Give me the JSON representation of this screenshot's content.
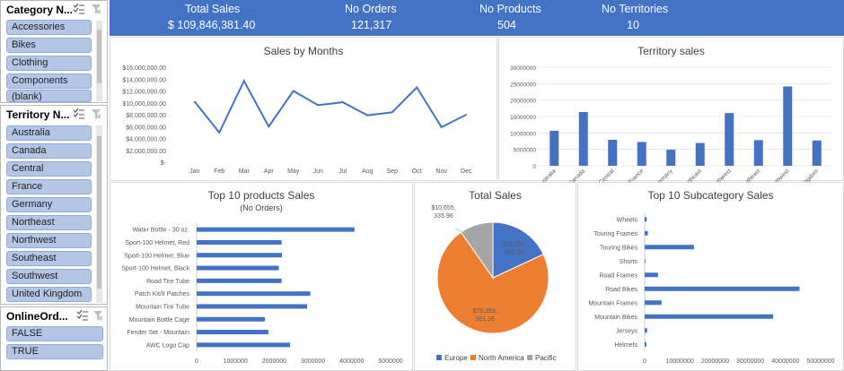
{
  "slicers": {
    "category": {
      "title": "Category N...",
      "items": [
        "Accessories",
        "Bikes",
        "Clothing",
        "Components",
        "(blank)"
      ]
    },
    "territory": {
      "title": "Territory N...",
      "items": [
        "Australia",
        "Canada",
        "Central",
        "France",
        "Germany",
        "Northeast",
        "Northwest",
        "Southeast",
        "Southwest",
        "United Kingdom"
      ]
    },
    "online_order": {
      "title": "OnlineOrd...",
      "items": [
        "FALSE",
        "TRUE"
      ]
    }
  },
  "kpis": [
    {
      "label": "Total Sales",
      "value": "$ 109,846,381.40"
    },
    {
      "label": "No Orders",
      "value": "121,317"
    },
    {
      "label": "No Products",
      "value": "504"
    },
    {
      "label": "No Territories",
      "value": "10"
    }
  ],
  "colors": {
    "accent": "#4472c4",
    "orange": "#ed7d31",
    "gray": "#a5a5a5",
    "slicer_item": "#b4c6e7"
  },
  "chart_data": [
    {
      "id": "sales_by_months",
      "type": "line",
      "title": "Sales by Months",
      "categories": [
        "Jan",
        "Feb",
        "Mar",
        "Apr",
        "May",
        "Jun",
        "Jul",
        "Aug",
        "Sep",
        "Oct",
        "Nov",
        "Dec"
      ],
      "values": [
        10200000,
        5000000,
        13700000,
        6000000,
        12000000,
        9600000,
        10100000,
        7900000,
        8400000,
        12600000,
        5900000,
        8000000
      ],
      "y_ticks": [
        "$-",
        "$2,000,000.00",
        "$4,000,000.00",
        "$6,000,000.00",
        "$8,000,000.00",
        "$10,000,000.00",
        "$12,000,000.00",
        "$14,000,000.00",
        "$16,000,000.00"
      ],
      "ylim": [
        0,
        16000000
      ],
      "grid": false
    },
    {
      "id": "territory_sales",
      "type": "bar",
      "title": "Territory sales",
      "categories": [
        "Australia",
        "Canada",
        "Central",
        "France",
        "Germany",
        "Northeast",
        "Northwest",
        "Southeast",
        "Southwest",
        "United Kingdom"
      ],
      "values": [
        10650000,
        16350000,
        7900000,
        7250000,
        4900000,
        6950000,
        16050000,
        7800000,
        24150000,
        7700000
      ],
      "y_ticks": [
        "0",
        "5000000",
        "10000000",
        "15000000",
        "20000000",
        "25000000",
        "30000000"
      ],
      "ylim": [
        0,
        30000000
      ],
      "grid": true
    },
    {
      "id": "top_products",
      "type": "bar",
      "orientation": "horizontal",
      "title": "Top 10 products Sales",
      "subtitle": "(No Orders)",
      "categories": [
        "Water Bottle - 30 oz.",
        "Sport-100 Helmet, Red",
        "Sport-100 Helmet, Blue",
        "Sport-100 Helmet, Black",
        "Road Tire Tube",
        "Patch Kit/8 Patches",
        "Mountain Tire Tube",
        "Mountain Bottle Cage",
        "Fender Set - Mountain",
        "AWC Logo Cap"
      ],
      "values": [
        4070000,
        2190000,
        2200000,
        2120000,
        2190000,
        2930000,
        2850000,
        1760000,
        1850000,
        2410000
      ],
      "x_ticks": [
        "0",
        "1000000",
        "2000000",
        "3000000",
        "4000000",
        "5000000"
      ],
      "xlim": [
        0,
        5000000
      ]
    },
    {
      "id": "total_sales_pie",
      "type": "pie",
      "title": "Total Sales",
      "categories": [
        "Europe",
        "North America",
        "Pacific"
      ],
      "values": [
        19837684.28,
        79353361.16,
        10655335.96
      ],
      "data_labels": [
        {
          "line1": "$19,837,",
          "line2": "684.28"
        },
        {
          "line1": "$79,353,",
          "line2": "361.16"
        },
        {
          "line1": "$10,655,",
          "line2": "335.96"
        }
      ],
      "legend": "bottom"
    },
    {
      "id": "top_subcategory",
      "type": "bar",
      "orientation": "horizontal",
      "title": "Top 10 Subcategory Sales",
      "categories": [
        "Wheels",
        "Touring Frames",
        "Touring Bikes",
        "Shorts",
        "Road Frames",
        "Road Bikes",
        "Mountain Frames",
        "Mountain Bikes",
        "Jerseys",
        "Helmets"
      ],
      "values": [
        600000,
        900000,
        14000000,
        200000,
        3800000,
        44000000,
        4800000,
        36500000,
        700000,
        500000
      ],
      "x_ticks": [
        "0",
        "10000000",
        "20000000",
        "30000000",
        "40000000",
        "50000000"
      ],
      "xlim": [
        0,
        50000000
      ]
    }
  ]
}
